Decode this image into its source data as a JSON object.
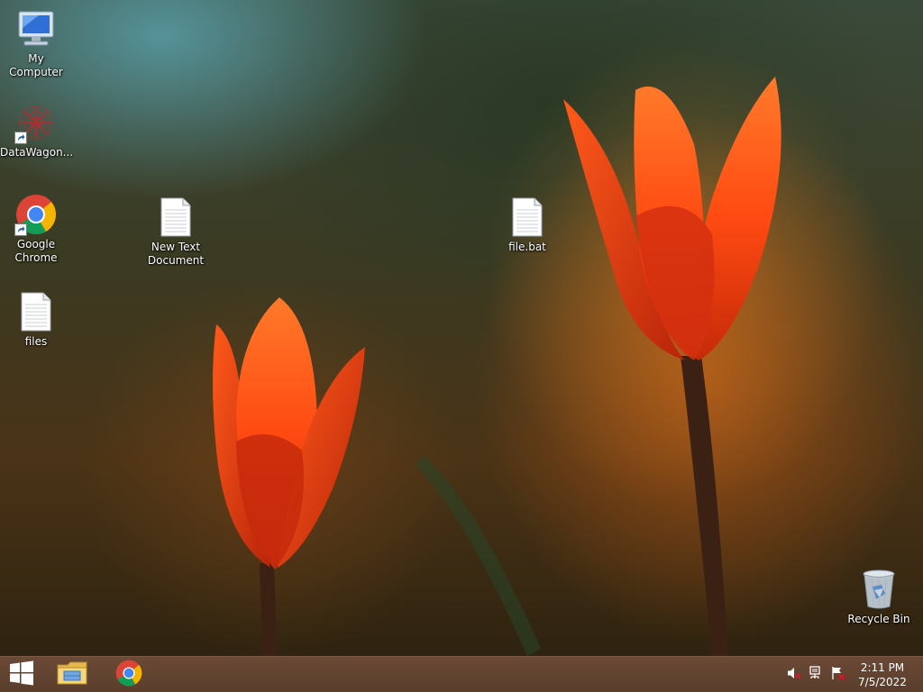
{
  "desktop": {
    "icons": [
      {
        "label": "My Computer",
        "icon": "computer-icon"
      },
      {
        "label": "DataWagon...",
        "icon": "datawagon-icon",
        "shortcut": true
      },
      {
        "label": "Google\nChrome",
        "icon": "chrome-icon",
        "shortcut": true
      },
      {
        "label": "files",
        "icon": "text-file-icon"
      },
      {
        "label": "New Text\nDocument",
        "icon": "text-file-icon"
      },
      {
        "label": "file.bat",
        "icon": "text-file-icon"
      },
      {
        "label": "Recycle Bin",
        "icon": "recycle-bin-icon"
      }
    ]
  },
  "taskbar": {
    "pinned": [
      {
        "name": "start",
        "icon": "windows-logo-icon"
      },
      {
        "name": "file-explorer",
        "icon": "folder-icon"
      },
      {
        "name": "chrome",
        "icon": "chrome-icon"
      }
    ],
    "tray_icons": [
      "volume-muted-icon",
      "network-icon",
      "action-center-flag-icon"
    ],
    "clock": {
      "time": "2:11 PM",
      "date": "7/5/2022"
    }
  },
  "colors": {
    "taskbar": "#5e3f2e",
    "tulip": "#ff4a10",
    "chrome_red": "#db4437",
    "chrome_green": "#0f9d58",
    "chrome_yellow": "#f4b400",
    "chrome_blue": "#4285f4"
  }
}
